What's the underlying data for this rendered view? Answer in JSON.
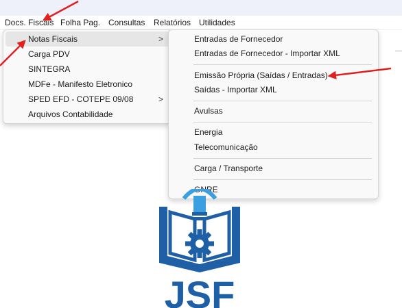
{
  "menubar": {
    "items": [
      "Docs. Fiscais",
      "Folha Pag.",
      "Consultas",
      "Relatórios",
      "Utilidades"
    ]
  },
  "submenu1": {
    "items": [
      {
        "label": "Notas Fiscais",
        "has_submenu": true
      },
      {
        "label": "Carga PDV"
      },
      {
        "label": "SINTEGRA"
      },
      {
        "label": "MDFe - Manifesto Eletronico"
      },
      {
        "label": "SPED EFD - COTEPE 09/08",
        "has_submenu": true
      },
      {
        "label": "Arquivos Contabilidade"
      }
    ]
  },
  "submenu2": {
    "items": [
      {
        "label": "Entradas de Fornecedor"
      },
      {
        "label": "Entradas de Fornecedor - Importar XML"
      },
      {
        "label": "Emissão Própria (Saídas / Entradas)"
      },
      {
        "label": "Saídas - Importar XML"
      },
      {
        "label": "Avulsas"
      },
      {
        "label": "Energia"
      },
      {
        "label": "Telecomunicação"
      },
      {
        "label": "Carga / Transporte"
      },
      {
        "label": "GNRE"
      }
    ]
  },
  "chevron_glyph": ">",
  "logo": {
    "text": "JSF",
    "color": "#1f5fa6",
    "accent": "#3b9fe0"
  },
  "colors": {
    "arrow": "#e02020",
    "menu_bg": "#f9f9f9",
    "highlight": "#e6e6e6",
    "topstrip": "#eef1fa"
  }
}
